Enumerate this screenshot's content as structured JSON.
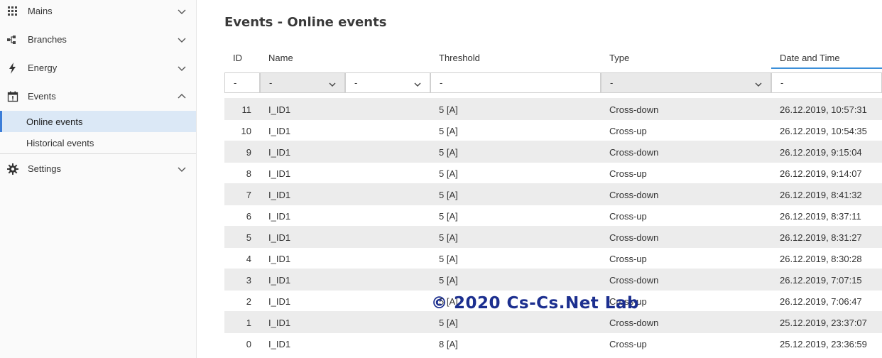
{
  "sidebar": {
    "items": [
      {
        "label": "Mains",
        "icon": "grid-icon",
        "expanded": false
      },
      {
        "label": "Branches",
        "icon": "branches-icon",
        "expanded": false
      },
      {
        "label": "Energy",
        "icon": "lightning-icon",
        "expanded": false
      },
      {
        "label": "Events",
        "icon": "events-calendar-icon",
        "expanded": true
      },
      {
        "label": "Settings",
        "icon": "gear-icon",
        "expanded": false
      }
    ],
    "subitems": [
      {
        "label": "Online events",
        "active": true
      },
      {
        "label": "Historical events",
        "active": false
      }
    ]
  },
  "page": {
    "title": "Events - Online events"
  },
  "table": {
    "columns": [
      "ID",
      "Name",
      "Threshold",
      "Type",
      "Date and Time"
    ],
    "sorted_column": "Date and Time",
    "filters": {
      "id": "-",
      "name_select": "-",
      "name_select2": "-",
      "threshold": "-",
      "type_select": "-",
      "datetime": "-"
    },
    "rows": [
      {
        "id": "11",
        "name": "I_ID1",
        "threshold": "5 [A]",
        "type": "Cross-down",
        "datetime": "26.12.2019, 10:57:31"
      },
      {
        "id": "10",
        "name": "I_ID1",
        "threshold": "5 [A]",
        "type": "Cross-up",
        "datetime": "26.12.2019, 10:54:35"
      },
      {
        "id": "9",
        "name": "I_ID1",
        "threshold": "5 [A]",
        "type": "Cross-down",
        "datetime": "26.12.2019, 9:15:04"
      },
      {
        "id": "8",
        "name": "I_ID1",
        "threshold": "5 [A]",
        "type": "Cross-up",
        "datetime": "26.12.2019, 9:14:07"
      },
      {
        "id": "7",
        "name": "I_ID1",
        "threshold": "5 [A]",
        "type": "Cross-down",
        "datetime": "26.12.2019, 8:41:32"
      },
      {
        "id": "6",
        "name": "I_ID1",
        "threshold": "5 [A]",
        "type": "Cross-up",
        "datetime": "26.12.2019, 8:37:11"
      },
      {
        "id": "5",
        "name": "I_ID1",
        "threshold": "5 [A]",
        "type": "Cross-down",
        "datetime": "26.12.2019, 8:31:27"
      },
      {
        "id": "4",
        "name": "I_ID1",
        "threshold": "5 [A]",
        "type": "Cross-up",
        "datetime": "26.12.2019, 8:30:28"
      },
      {
        "id": "3",
        "name": "I_ID1",
        "threshold": "5 [A]",
        "type": "Cross-down",
        "datetime": "26.12.2019, 7:07:15"
      },
      {
        "id": "2",
        "name": "I_ID1",
        "threshold": "5 [A]",
        "type": "Cross-up",
        "datetime": "26.12.2019, 7:06:47"
      },
      {
        "id": "1",
        "name": "I_ID1",
        "threshold": "5 [A]",
        "type": "Cross-down",
        "datetime": "25.12.2019, 23:37:07"
      },
      {
        "id": "0",
        "name": "I_ID1",
        "threshold": "8 [A]",
        "type": "Cross-up",
        "datetime": "25.12.2019, 23:36:59"
      }
    ]
  },
  "watermark": "© 2020 Cs-Cs.Net Lab",
  "colors": {
    "accent": "#3b8fd9",
    "active_bg": "#dbe8f6",
    "watermark": "#1c2f8f"
  }
}
